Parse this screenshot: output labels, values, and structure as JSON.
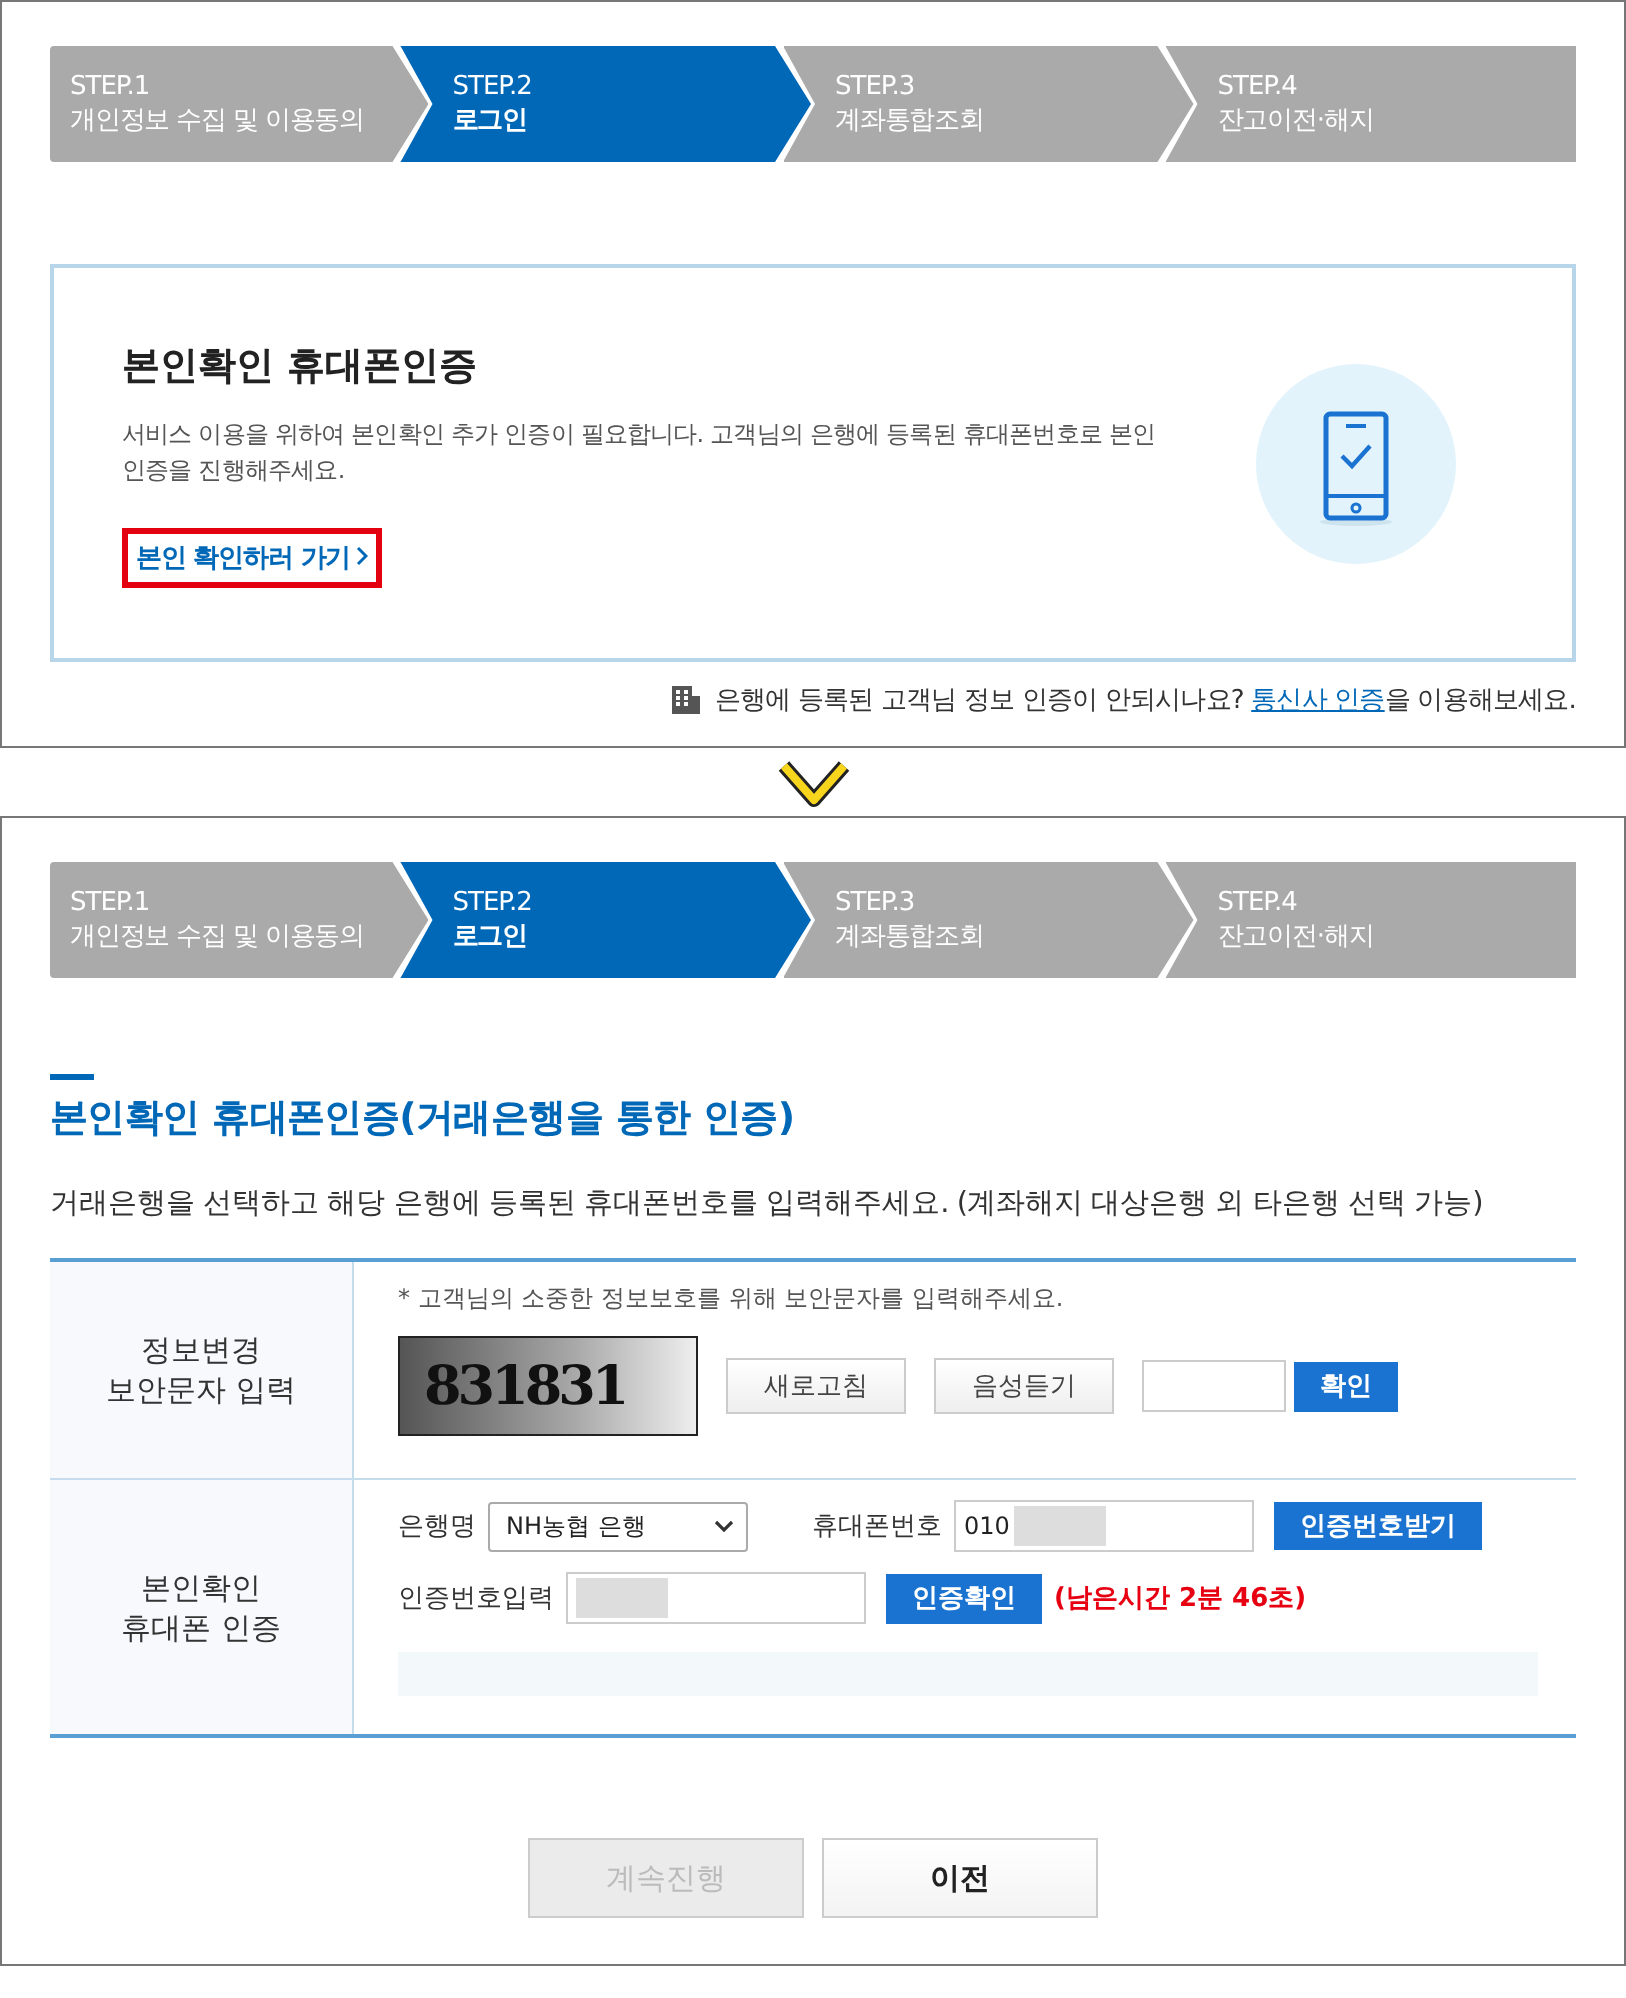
{
  "top_panel": {
    "steps": [
      {
        "number": "STEP.1",
        "label": "개인정보 수집 및 이용동의",
        "selected": false
      },
      {
        "number": "STEP.2",
        "label": "로그인",
        "selected": true
      },
      {
        "number": "STEP.3",
        "label": "계좌통합조회",
        "selected": false
      },
      {
        "number": "STEP.4",
        "label": "잔고이전·해지",
        "selected": false
      }
    ],
    "card": {
      "title": "본인확인 휴대폰인증",
      "description": "서비스 이용을 위하여 본인확인 추가 인증이 필요합니다. 고객님의 은행에 등록된 휴대폰번호로 본인인증을 진행해주세요.",
      "link": "본인 확인하러 가기",
      "link_highlighted": true
    },
    "help": {
      "before": "은행에 등록된 고객님 정보 인증이 안되시나요?",
      "link": "통신사 인증",
      "after": "을 이용해보세요."
    }
  },
  "bottom_panel": {
    "steps": [
      {
        "number": "STEP.1",
        "label": "개인정보 수집 및 이용동의",
        "selected": false
      },
      {
        "number": "STEP.2",
        "label": "로그인",
        "selected": true
      },
      {
        "number": "STEP.3",
        "label": "계좌통합조회",
        "selected": false
      },
      {
        "number": "STEP.4",
        "label": "잔고이전·해지",
        "selected": false
      }
    ],
    "title": "본인확인 휴대폰인증(거래은행을 통한 인증)",
    "instruction": "거래은행을 선택하고 해당 은행에 등록된 휴대폰번호를 입력해주세요. (계좌해지 대상은행 외 타은행 선택 가능)",
    "captcha_row": {
      "header": "정보변경\n보안문자 입력",
      "notice": "* 고객님의 소중한 정보보호를 위해 보안문자를 입력해주세요.",
      "captcha": "831831",
      "refresh_button": "새로고침",
      "audio_button": "음성듣기",
      "confirm_button": "확인"
    },
    "phone_row": {
      "header": "본인확인\n휴대폰 인증",
      "bank_label": "은행명",
      "bank_value": "NH농협 은행",
      "phone_label": "휴대폰번호",
      "phone_value": "010",
      "request_button": "인증번호받기",
      "code_label": "인증번호입력",
      "verify_button": "인증확인",
      "timer": "(남은시간 2분 46초)"
    },
    "buttons": [
      {
        "label": "계속진행",
        "disabled": true
      },
      {
        "label": "이전",
        "disabled": false
      }
    ]
  }
}
